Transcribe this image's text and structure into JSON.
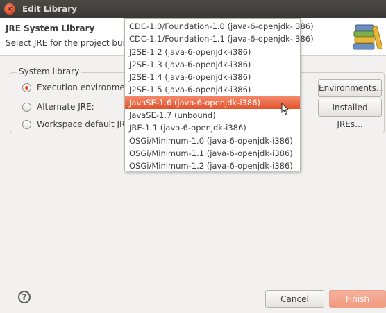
{
  "window": {
    "title": "Edit Library"
  },
  "header": {
    "title": "JRE System Library",
    "description": "Select JRE for the project buil"
  },
  "system_library": {
    "legend": "System library",
    "execution_environment_label": "Execution environment:",
    "alternate_jre_label": "Alternate JRE:",
    "workspace_default_label": "Workspace default JRE (j",
    "environments_button": "Environments...",
    "installed_jres_button": "Installed JREs...",
    "selected_option": "execution_environment"
  },
  "dropdown": {
    "items": [
      "CDC-1.0/Foundation-1.0 (java-6-openjdk-i386)",
      "CDC-1.1/Foundation-1.1 (java-6-openjdk-i386)",
      "J2SE-1.2 (java-6-openjdk-i386)",
      "J2SE-1.3 (java-6-openjdk-i386)",
      "J2SE-1.4 (java-6-openjdk-i386)",
      "J2SE-1.5 (java-6-openjdk-i386)",
      "JavaSE-1.6 (java-6-openjdk-i386)",
      "JavaSE-1.7 (unbound)",
      "JRE-1.1 (java-6-openjdk-i386)",
      "OSGi/Minimum-1.0 (java-6-openjdk-i386)",
      "OSGi/Minimum-1.1 (java-6-openjdk-i386)",
      "OSGi/Minimum-1.2 (java-6-openjdk-i386)"
    ],
    "selected_index": 6
  },
  "footer": {
    "help_icon_glyph": "?",
    "cancel_label": "Cancel",
    "finish_label": "Finish"
  },
  "colors": {
    "accent": "#e2532c",
    "titlebar": "#3f3e3a"
  }
}
